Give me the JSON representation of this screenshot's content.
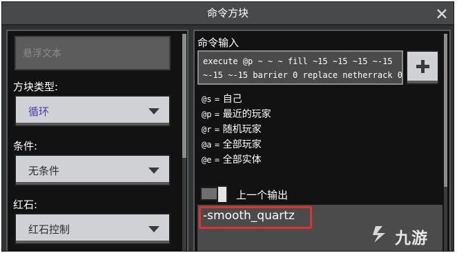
{
  "window": {
    "title": "命令方块"
  },
  "left_panel": {
    "hover_text_placeholder": "悬浮文本",
    "block_type": {
      "label": "方块类型:",
      "value": "循环",
      "value_color": "#4a3ca8"
    },
    "condition": {
      "label": "条件:",
      "value": "无条件"
    },
    "redstone": {
      "label": "红石:",
      "value": "红石控制"
    }
  },
  "right_panel": {
    "command_label": "命令输入",
    "command_lines": [
      "execute @p ~ ~ ~ fill ~15 ~15 ~15 ~-15",
      "~-15 ~-15 barrier 0 replace netherrack 0"
    ],
    "selectors": [
      {
        "code": "@s",
        "eq": "=",
        "desc": "自己"
      },
      {
        "code": "@p",
        "eq": "=",
        "desc": "最近的玩家"
      },
      {
        "code": "@r",
        "eq": "=",
        "desc": "随机玩家"
      },
      {
        "code": "@a",
        "eq": "=",
        "desc": "全部玩家"
      },
      {
        "code": "@e",
        "eq": "=",
        "desc": "全部实体"
      }
    ],
    "previous_output_label": "上一个输出",
    "output_text": "-smooth_quartz"
  },
  "colors": {
    "highlight": "#e0322f",
    "panel_bg": "#121212",
    "button": "#d0d1d4"
  },
  "watermark": {
    "text": "九游"
  }
}
